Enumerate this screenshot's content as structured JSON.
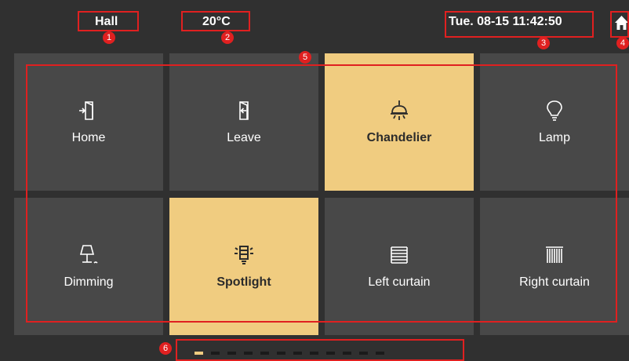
{
  "topbar": {
    "room": "Hall",
    "temperature": "20°C",
    "datetime": "Tue. 08-15 11:42:50",
    "home_icon": "home-icon"
  },
  "tiles": [
    {
      "label": "Home",
      "icon": "enter-door-icon",
      "active": false
    },
    {
      "label": "Leave",
      "icon": "exit-door-icon",
      "active": false
    },
    {
      "label": "Chandelier",
      "icon": "chandelier-icon",
      "active": true
    },
    {
      "label": "Lamp",
      "icon": "bulb-icon",
      "active": false
    },
    {
      "label": "Dimming",
      "icon": "table-lamp-icon",
      "active": false
    },
    {
      "label": "Spotlight",
      "icon": "spotlight-bulb-icon",
      "active": true
    },
    {
      "label": "Left curtain",
      "icon": "horizontal-blinds-icon",
      "active": false
    },
    {
      "label": "Right curtain",
      "icon": "vertical-blinds-icon",
      "active": false
    }
  ],
  "pager": {
    "pages": 12,
    "current": 1
  },
  "annotations": [
    "1",
    "2",
    "3",
    "4",
    "5",
    "6"
  ],
  "colors": {
    "background": "#303030",
    "tile": "#484848",
    "active": "#f0cc80",
    "annotation": "#e02020"
  }
}
